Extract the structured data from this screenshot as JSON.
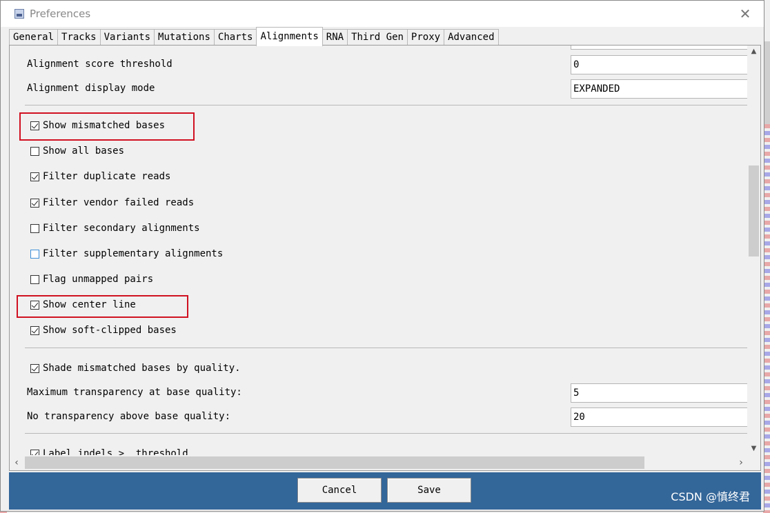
{
  "window": {
    "title": "Preferences"
  },
  "tabs": [
    {
      "label": "General"
    },
    {
      "label": "Tracks"
    },
    {
      "label": "Variants"
    },
    {
      "label": "Mutations"
    },
    {
      "label": "Charts"
    },
    {
      "label": "Alignments",
      "active": true
    },
    {
      "label": "RNA"
    },
    {
      "label": "Third Gen"
    },
    {
      "label": "Proxy"
    },
    {
      "label": "Advanced"
    }
  ],
  "fields": {
    "score_threshold": {
      "label": "Alignment score threshold",
      "value": "0"
    },
    "display_mode": {
      "label": "Alignment display mode",
      "value": "EXPANDED"
    },
    "max_transparency": {
      "label": "Maximum transparency at base quality:",
      "value": "5"
    },
    "no_transparency": {
      "label": "No transparency above base quality:",
      "value": "20"
    }
  },
  "checkboxes": {
    "show_mismatched": {
      "label": "Show mismatched bases",
      "checked": true
    },
    "show_all_bases": {
      "label": "Show all bases",
      "checked": false
    },
    "filter_duplicate": {
      "label": "Filter duplicate reads",
      "checked": true
    },
    "filter_vendor": {
      "label": "Filter vendor failed reads",
      "checked": true
    },
    "filter_secondary": {
      "label": "Filter secondary alignments",
      "checked": false
    },
    "filter_supplementary": {
      "label": "Filter supplementary alignments",
      "checked": false
    },
    "flag_unmapped": {
      "label": "Flag unmapped pairs",
      "checked": false
    },
    "show_center_line": {
      "label": "Show center line",
      "checked": true
    },
    "show_soft_clipped": {
      "label": "Show soft-clipped bases",
      "checked": true
    },
    "shade_mismatched": {
      "label": "Shade mismatched bases by quality.",
      "checked": true
    },
    "label_indels": {
      "label": "Label indels >  threshold",
      "checked": true
    }
  },
  "buttons": {
    "cancel": "Cancel",
    "save": "Save"
  },
  "watermark": "CSDN @慎终君",
  "colors": {
    "footer": "#336699",
    "highlight": "#d01020"
  }
}
